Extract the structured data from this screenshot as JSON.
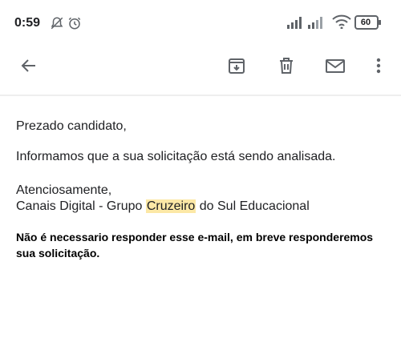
{
  "status_bar": {
    "time": "0:59",
    "battery": "60",
    "icons_left": [
      "muted-bell-icon",
      "alarm-icon"
    ],
    "icons_right": [
      "signal-icon",
      "signal-icon",
      "wifi-icon",
      "battery-icon"
    ]
  },
  "toolbar": {
    "back_icon": "back-arrow-icon",
    "actions": [
      "archive-icon",
      "delete-icon",
      "mark-unread-icon",
      "more-vert-icon"
    ]
  },
  "email": {
    "greeting": "Prezado candidato,",
    "body": "Informamos que a sua solicitação está sendo analisada.",
    "closing": "Atenciosamente,",
    "signature_before": "Canais Digital - Grupo ",
    "signature_highlight": "Cruzeiro",
    "signature_after": " do Sul Educacional",
    "note": "Não é necessario responder esse e-mail, em breve responderemos sua solicitação."
  },
  "colors": {
    "highlight": "#fce8a6",
    "icon": "#5f6368",
    "text": "#202124"
  }
}
